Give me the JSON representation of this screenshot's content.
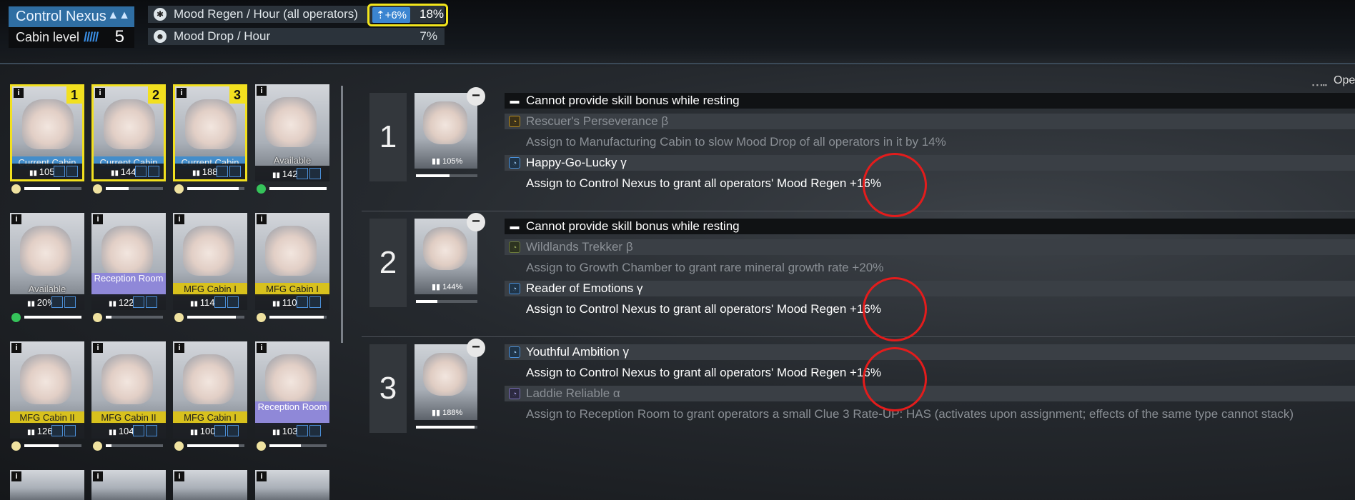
{
  "header": {
    "room_name": "Control Nexus",
    "cabin_level_label": "Cabin level",
    "cabin_level_value": "5",
    "mood_regen_label": "Mood Regen / Hour (all operators)",
    "mood_regen_boost": "+6%",
    "mood_regen_value": "18%",
    "mood_drop_label": "Mood Drop / Hour",
    "mood_drop_value": "7%"
  },
  "operators": [
    {
      "slot": "1",
      "location": "Current Cabin",
      "efficiency": "105%",
      "mood": 0.62
    },
    {
      "slot": "2",
      "location": "Current Cabin",
      "efficiency": "144%",
      "mood": 0.4
    },
    {
      "slot": "3",
      "location": "Current Cabin",
      "efficiency": "188%",
      "mood": 0.9
    },
    {
      "slot": "",
      "location": "Available",
      "efficiency": "142%",
      "mood": 1.0
    },
    {
      "slot": "",
      "location": "Available",
      "efficiency": "20%",
      "mood": 1.0
    },
    {
      "slot": "",
      "location": "Reception Room",
      "efficiency": "122%",
      "mood": 0.1
    },
    {
      "slot": "",
      "location": "MFG Cabin I",
      "efficiency": "114%",
      "mood": 0.85
    },
    {
      "slot": "",
      "location": "MFG Cabin I",
      "efficiency": "110%",
      "mood": 0.95
    },
    {
      "slot": "",
      "location": "MFG Cabin II",
      "efficiency": "126%",
      "mood": 0.6
    },
    {
      "slot": "",
      "location": "MFG Cabin II",
      "efficiency": "104%",
      "mood": 0.1
    },
    {
      "slot": "",
      "location": "MFG Cabin I",
      "efficiency": "100%",
      "mood": 0.9
    },
    {
      "slot": "",
      "location": "Reception Room",
      "efficiency": "103%",
      "mood": 0.55
    }
  ],
  "slots": [
    {
      "number": "1",
      "efficiency": "105%",
      "mood": 0.55,
      "rows": [
        {
          "text": "Cannot provide skill bonus while resting",
          "style": "rest"
        },
        {
          "text": "Rescuer's Perseverance β",
          "style": "skill-dim",
          "icon": "gold"
        },
        {
          "text": "Assign to Manufacturing Cabin to slow Mood Drop of all operators in it by 14%",
          "style": "desc-dim"
        },
        {
          "text": "Happy-Go-Lucky γ",
          "style": "skill",
          "icon": "blue"
        },
        {
          "text": "Assign to Control Nexus to grant all operators' Mood Regen +16%",
          "style": "desc"
        }
      ]
    },
    {
      "number": "2",
      "efficiency": "144%",
      "mood": 0.35,
      "rows": [
        {
          "text": "Cannot provide skill bonus while resting",
          "style": "rest"
        },
        {
          "text": "Wildlands Trekker β",
          "style": "skill-dim",
          "icon": "olive"
        },
        {
          "text": "Assign to Growth Chamber to grant rare mineral growth rate +20%",
          "style": "desc-dim"
        },
        {
          "text": "Reader of Emotions γ",
          "style": "skill",
          "icon": "blue"
        },
        {
          "text": "Assign to Control Nexus to grant all operators' Mood Regen +16%",
          "style": "desc"
        }
      ]
    },
    {
      "number": "3",
      "efficiency": "188%",
      "mood": 0.95,
      "rows": [
        {
          "text": "Youthful Ambition γ",
          "style": "skill",
          "icon": "blue"
        },
        {
          "text": "Assign to Control Nexus to grant all operators' Mood Regen +16%",
          "style": "desc"
        },
        {
          "text": "Laddie Reliable α",
          "style": "skill-dim",
          "icon": "purp"
        },
        {
          "text": "Assign to Reception Room to grant operators a small Clue 3 Rate-UP: HAS (activates upon assignment; effects of the same type cannot stack)",
          "style": "desc-dim"
        }
      ]
    }
  ],
  "top_right_label": "Ope"
}
